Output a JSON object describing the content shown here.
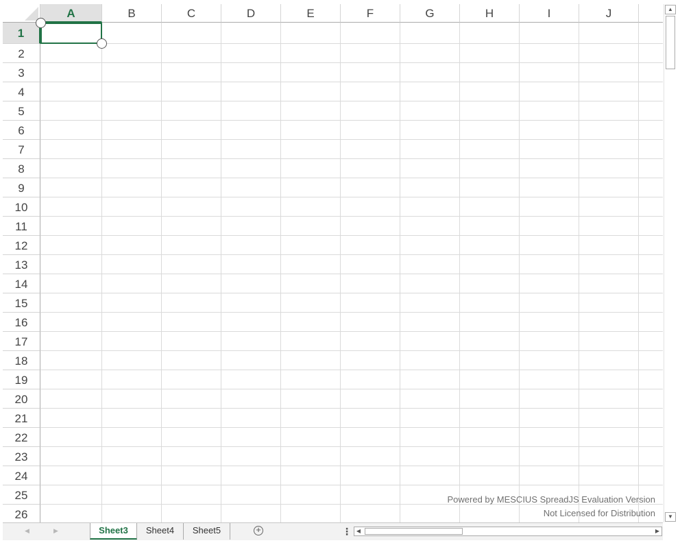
{
  "spreadsheet": {
    "columns": [
      "A",
      "B",
      "C",
      "D",
      "E",
      "F",
      "G",
      "H",
      "I",
      "J"
    ],
    "rows": [
      "1",
      "2",
      "3",
      "4",
      "5",
      "6",
      "7",
      "8",
      "9",
      "10",
      "11",
      "12",
      "13",
      "14",
      "15",
      "16",
      "17",
      "18",
      "19",
      "20",
      "21",
      "22",
      "23",
      "24",
      "25",
      "26"
    ],
    "selected_column": "A",
    "selected_row": "1"
  },
  "watermark": {
    "line1": "Powered by MESCIUS SpreadJS Evaluation Version",
    "line2": "Not Licensed for Distribution"
  },
  "tabs": {
    "items": [
      {
        "label": "Sheet3",
        "active": true
      },
      {
        "label": "Sheet4",
        "active": false
      },
      {
        "label": "Sheet5",
        "active": false
      }
    ],
    "add_label": "+",
    "menu_label": "⋮"
  },
  "colors": {
    "accent": "#217346",
    "header_selected_bg": "#e1e1e1",
    "gridline": "#dadada"
  }
}
